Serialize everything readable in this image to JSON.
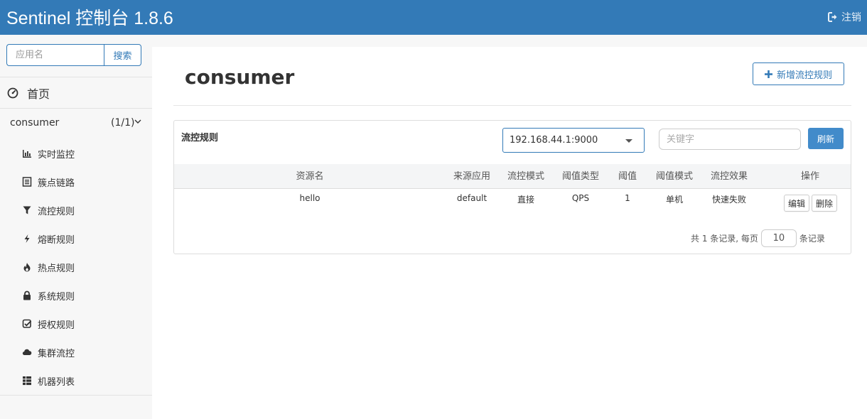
{
  "header": {
    "brand": "Sentinel 控制台 1.8.6",
    "logout_label": "注销"
  },
  "sidebar": {
    "search_placeholder": "应用名",
    "search_button": "搜索",
    "home_label": "首页",
    "app": {
      "name": "consumer",
      "count": "(1/1)"
    },
    "items": [
      {
        "label": "实时监控",
        "icon": "bar-chart-icon"
      },
      {
        "label": "簇点链路",
        "icon": "list-icon"
      },
      {
        "label": "流控规则",
        "icon": "filter-icon"
      },
      {
        "label": "熔断规则",
        "icon": "flash-icon"
      },
      {
        "label": "热点规则",
        "icon": "fire-icon"
      },
      {
        "label": "系统规则",
        "icon": "lock-icon"
      },
      {
        "label": "授权规则",
        "icon": "check-icon"
      },
      {
        "label": "集群流控",
        "icon": "cloud-icon"
      },
      {
        "label": "机器列表",
        "icon": "grid-icon"
      }
    ]
  },
  "main": {
    "title": "consumer",
    "add_button": "新增流控规则",
    "panel": {
      "title": "流控规则",
      "machine": "192.168.44.1:9000",
      "keyword_placeholder": "关键字",
      "refresh": "刷新",
      "columns": [
        "资源名",
        "来源应用",
        "流控模式",
        "阈值类型",
        "阈值",
        "阈值模式",
        "流控效果",
        "操作"
      ],
      "rows": [
        {
          "resource": "hello",
          "origin": "default",
          "mode": "直接",
          "grade": "QPS",
          "count": "1",
          "cluster": "单机",
          "effect": "快速失败",
          "edit": "编辑",
          "delete": "删除"
        }
      ],
      "pager": {
        "prefix": "共 1 条记录, 每页",
        "page_size": "10",
        "suffix": "条记录"
      }
    }
  },
  "colors": {
    "primary": "#337ab7",
    "button": "#428bca"
  }
}
